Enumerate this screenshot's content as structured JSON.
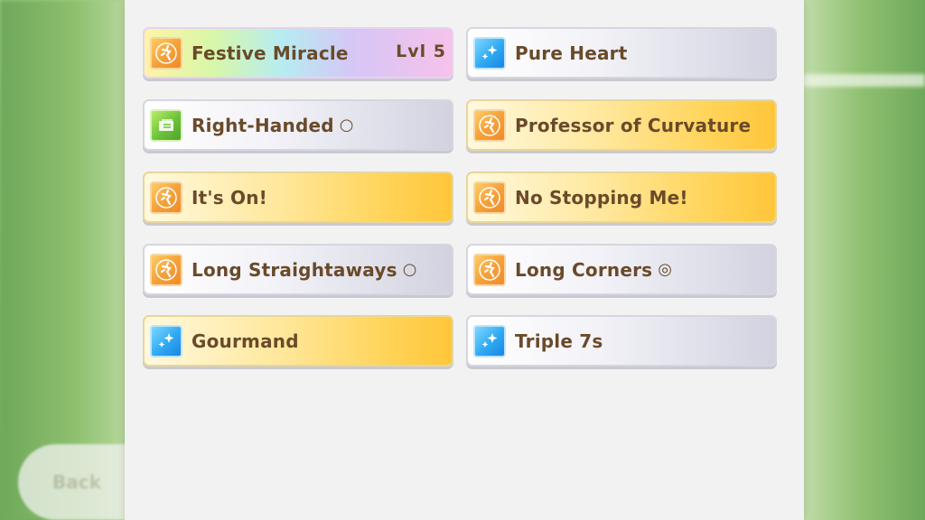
{
  "back_label": "Back",
  "skills": [
    {
      "name": "Festive Miracle",
      "level": "Lvl  5",
      "grade": "",
      "icon": "speed-icon",
      "style": "rainbow"
    },
    {
      "name": "Pure Heart",
      "grade": "",
      "icon": "sparkle-icon",
      "style": "white"
    },
    {
      "name": "Right-Handed",
      "grade": "○",
      "icon": "card-icon",
      "style": "white"
    },
    {
      "name": "Professor of Curvature",
      "grade": "",
      "icon": "speed-icon",
      "style": "gold"
    },
    {
      "name": "It's On!",
      "grade": "",
      "icon": "speed-icon",
      "style": "gold"
    },
    {
      "name": "No Stopping Me!",
      "grade": "",
      "icon": "speed-icon",
      "style": "gold"
    },
    {
      "name": "Long Straightaways",
      "grade": "○",
      "icon": "speed-icon",
      "style": "white"
    },
    {
      "name": "Long Corners",
      "grade": "◎",
      "icon": "speed-icon",
      "style": "white"
    },
    {
      "name": "Gourmand",
      "grade": "",
      "icon": "sparkle-icon",
      "style": "gold"
    },
    {
      "name": "Triple 7s",
      "grade": "",
      "icon": "sparkle-icon",
      "style": "white"
    }
  ]
}
